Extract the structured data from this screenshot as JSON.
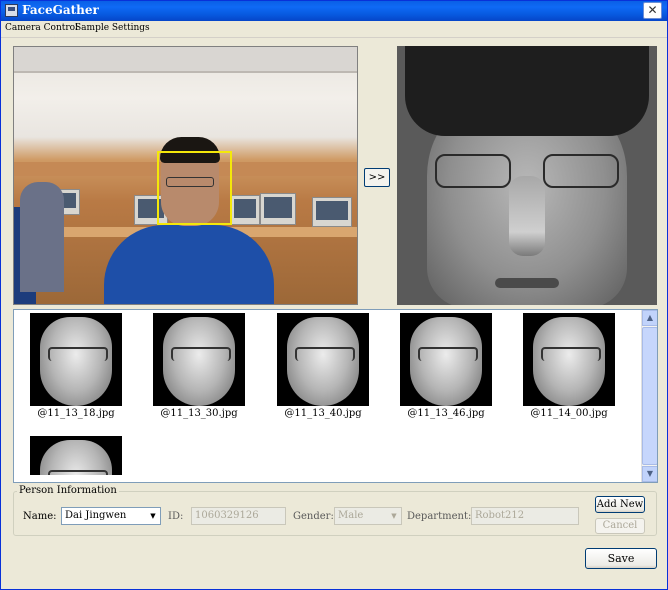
{
  "window": {
    "title": "FaceGather"
  },
  "menu": [
    {
      "label": "Camera Control"
    },
    {
      "label": "Sample Settings"
    }
  ],
  "video": {
    "transfer_label": ">>"
  },
  "gallery": {
    "items": [
      {
        "filename": "@11_13_18.jpg"
      },
      {
        "filename": "@11_13_30.jpg"
      },
      {
        "filename": "@11_13_40.jpg"
      },
      {
        "filename": "@11_13_46.jpg"
      },
      {
        "filename": "@11_14_00.jpg"
      },
      {
        "filename": ""
      }
    ]
  },
  "person_info": {
    "legend": "Person Information",
    "name_label": "Name:",
    "name_value": "Dai Jingwen",
    "id_label": "ID:",
    "id_value": "1060329126",
    "gender_label": "Gender:",
    "gender_value": "Male",
    "department_label": "Department:",
    "department_value": "Robot212",
    "add_new_label": "Add New",
    "cancel_label": "Cancel"
  },
  "footer": {
    "save_label": "Save"
  },
  "icons": {
    "close": "close-icon",
    "combo": "chevron-down-icon",
    "scroll_up": "scroll-up-icon",
    "scroll_down": "scroll-down-icon"
  },
  "colors": {
    "titlebar": "#0a5fe6",
    "face_box": "#f4e80a",
    "window_bg": "#ece9d8"
  }
}
